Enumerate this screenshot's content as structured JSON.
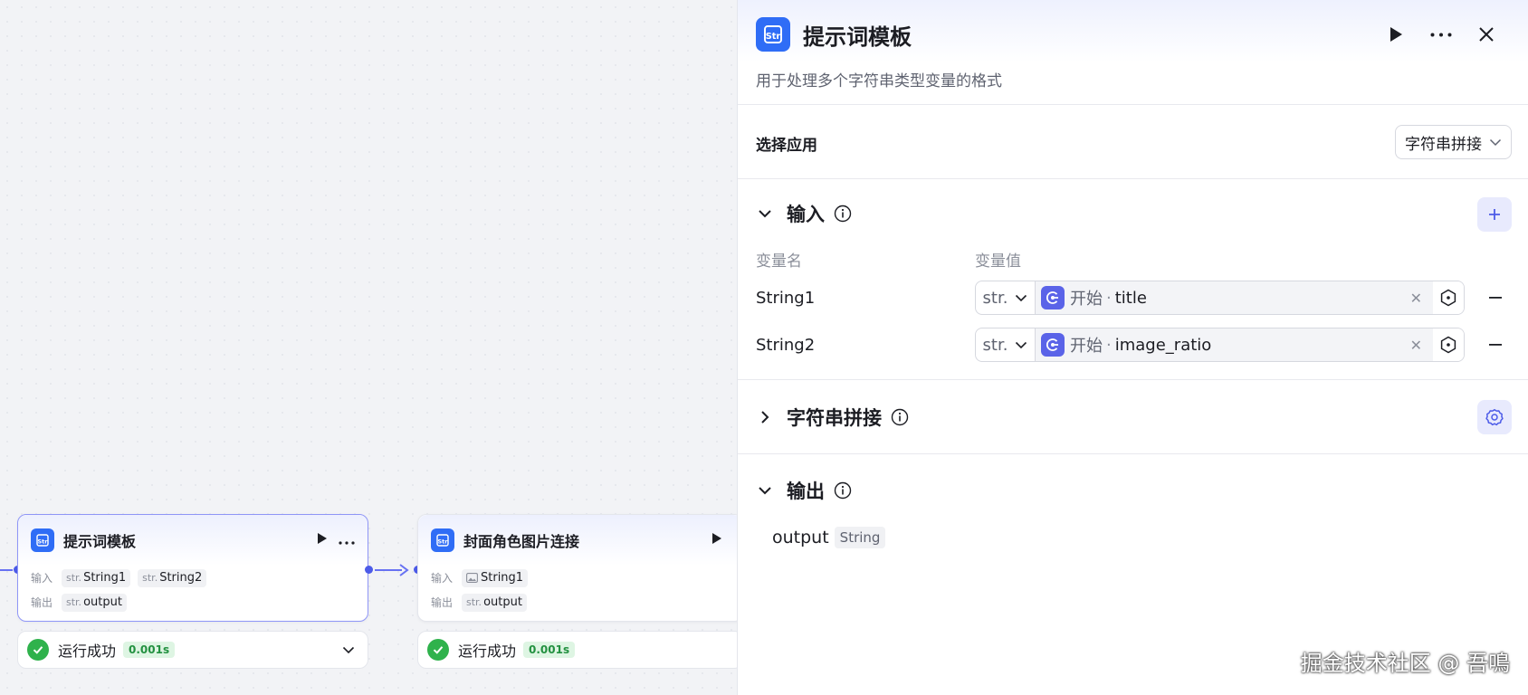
{
  "canvas": {
    "node1": {
      "title": "提示词模板",
      "input_label": "输入",
      "output_label": "输出",
      "inputs": [
        {
          "prefix": "str.",
          "name": "String1"
        },
        {
          "prefix": "str.",
          "name": "String2"
        }
      ],
      "outputs": [
        {
          "prefix": "str.",
          "name": "output"
        }
      ],
      "status": "运行成功",
      "time": "0.001s"
    },
    "node2": {
      "title": "封面角色图片连接",
      "input_label": "输入",
      "output_label": "输出",
      "inputs": [
        {
          "prefix": "image-icon",
          "name": "String1"
        }
      ],
      "outputs": [
        {
          "prefix": "str.",
          "name": "output"
        }
      ],
      "status": "运行成功",
      "time": "0.001s"
    }
  },
  "panel": {
    "title": "提示词模板",
    "description": "用于处理多个字符串类型变量的格式",
    "select_app_label": "选择应用",
    "select_app_value": "字符串拼接",
    "input_section": {
      "title": "输入",
      "col_name": "变量名",
      "col_value": "变量值",
      "variables": [
        {
          "name": "String1",
          "type": "str.",
          "source": "开始",
          "key": "title"
        },
        {
          "name": "String2",
          "type": "str.",
          "source": "开始",
          "key": "image_ratio"
        }
      ]
    },
    "concat_section": {
      "title": "字符串拼接"
    },
    "output_section": {
      "title": "输出",
      "name": "output",
      "type": "String"
    }
  },
  "watermark": "掘金技术社区 @ 吾鳴",
  "colors": {
    "accent": "#4c5be8",
    "node_icon": "#2f6df6",
    "success": "#2fb24c"
  }
}
